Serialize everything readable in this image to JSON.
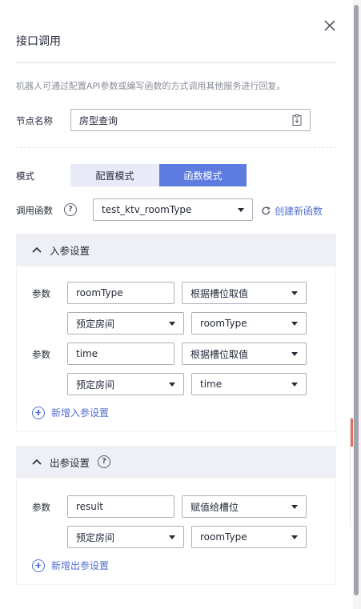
{
  "header": {
    "title": "接口调用"
  },
  "description": "机器人可通过配置API参数或编写函数的方式调用其他服务进行回复。",
  "node_name": {
    "label": "节点名称",
    "value": "房型查询"
  },
  "mode": {
    "label": "模式",
    "options": [
      "配置模式",
      "函数模式"
    ],
    "selected": "函数模式"
  },
  "call_function": {
    "label": "调用函数",
    "value": "test_ktv_roomType",
    "create_link": "创建新函数"
  },
  "input_section": {
    "title": "入参设置",
    "params": [
      {
        "label": "参数",
        "name": "roomType",
        "source": "根据槽位取值",
        "intent": "预定房间",
        "slot": "roomType"
      },
      {
        "label": "参数",
        "name": "time",
        "source": "根据槽位取值",
        "intent": "预定房间",
        "slot": "time"
      }
    ],
    "add_label": "新增入参设置"
  },
  "output_section": {
    "title": "出参设置",
    "params": [
      {
        "label": "参数",
        "name": "result",
        "source": "赋值给槽位",
        "intent": "预定房间",
        "slot": "roomType"
      }
    ],
    "add_label": "新增出参设置"
  },
  "help_glyph": "?",
  "colors": {
    "primary": "#5e7ce0",
    "link": "#526ecc",
    "segment_off": "#e8eaf8",
    "section_header": "#eef0f5"
  }
}
